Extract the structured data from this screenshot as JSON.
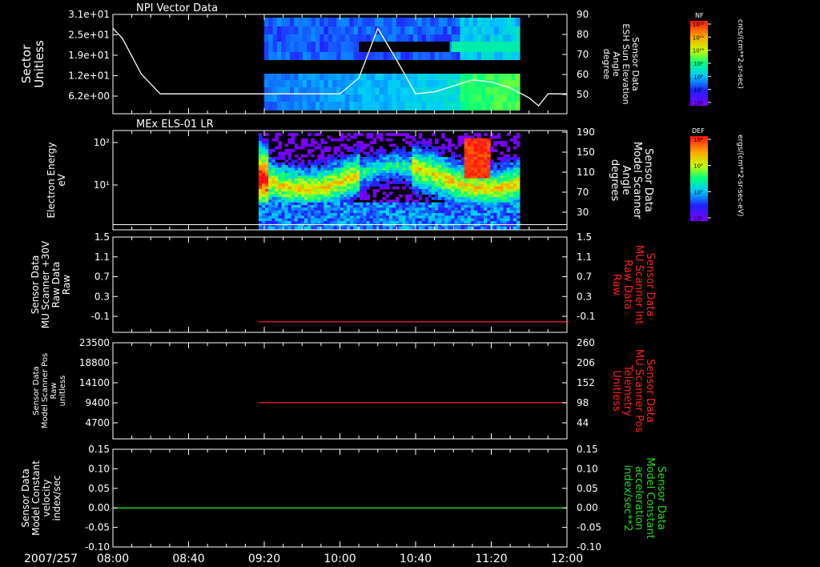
{
  "page": {
    "date_label": "2007/257",
    "time_ticks": [
      "08:00",
      "08:40",
      "09:20",
      "10:00",
      "10:40",
      "11:20",
      "12:00"
    ]
  },
  "colors": {
    "background": "#000000",
    "axis": "#ffffff",
    "red_trace": "#ff2020",
    "green_trace": "#22dd22",
    "right_label_red": "#ff2020",
    "right_label_green": "#22dd22"
  },
  "panels": [
    {
      "id": "npi",
      "title": "NPI Vector Data",
      "left_label": [
        "Sector",
        "Unitless"
      ],
      "left_ticks": [
        "3.1e+01",
        "2.5e+01",
        "1.9e+01",
        "1.2e+01",
        "6.2e+00"
      ],
      "right_label": [
        "Sensor Data",
        "ESH Sun Elevation",
        "Angle",
        "degree"
      ],
      "right_ticks": [
        "90",
        "80",
        "70",
        "60",
        "50"
      ],
      "colorbar_title": "NF",
      "colorbar_units": "cnts/(cm**2-sr-sec)",
      "colorbar_ticks": [
        "10¹²",
        "10¹¹",
        "10¹⁰",
        "10⁹",
        "10⁸",
        "10⁷",
        "10⁶"
      ]
    },
    {
      "id": "els",
      "title": "MEx ELS-01 LR",
      "left_label": [
        "Electron Energy",
        "eV"
      ],
      "left_ticks": [
        "10²",
        "10¹"
      ],
      "right_label": [
        "Sensor Data",
        "Model Scanner",
        "Angle",
        "degrees"
      ],
      "right_ticks": [
        "190",
        "150",
        "110",
        "70",
        "30"
      ],
      "colorbar_title": "DEF",
      "colorbar_units": "ergs/(cm**2-sr-sec-eV)",
      "colorbar_ticks": [
        "10⁴",
        "10³",
        "10²",
        "10¹"
      ]
    },
    {
      "id": "mu_raw",
      "left_label": [
        "Sensor Data",
        "MU Scanner +30V",
        "Raw Data",
        "Raw"
      ],
      "left_ticks": [
        "1.5",
        "1.1",
        "0.7",
        "0.3",
        "-0.1"
      ],
      "right_label": [
        "Sensor Data",
        "MU Scanner Int",
        "Raw Data",
        "Raw"
      ],
      "right_ticks": [
        "1.5",
        "1.1",
        "0.7",
        "0.3",
        "-0.1"
      ]
    },
    {
      "id": "scanner_pos",
      "left_label": [
        "Sensor Data",
        "Model Scanner Pos",
        "Raw",
        "unitless"
      ],
      "left_ticks": [
        "23500",
        "18800",
        "14100",
        "9400",
        "4700"
      ],
      "right_label": [
        "Sensor Data",
        "MU Scanner Pos",
        "Telemetry",
        "Unitless"
      ],
      "right_ticks": [
        "260",
        "206",
        "152",
        "98",
        "44"
      ]
    },
    {
      "id": "constant",
      "left_label": [
        "Sensor Data",
        "Model Constant",
        "velocity",
        "index/sec"
      ],
      "left_ticks": [
        "0.15",
        "0.10",
        "0.05",
        "0.00",
        "-0.05",
        "-0.10"
      ],
      "right_label": [
        "Sensor Data",
        "Model Constant",
        "acceleration",
        "index/sec**2"
      ],
      "right_ticks": [
        "0.15",
        "0.10",
        "0.05",
        "0.00",
        "-0.05",
        "-0.10"
      ]
    }
  ],
  "chart_data": [
    {
      "type": "heatmap",
      "title": "NPI Vector Data",
      "x_range": [
        "08:00",
        "12:00"
      ],
      "data_coverage": [
        "09:20",
        "11:35"
      ],
      "overlay_line": {
        "name": "ESH Sun Elevation Angle",
        "x": [
          "08:00",
          "08:05",
          "08:15",
          "08:25",
          "09:20",
          "10:00",
          "10:10",
          "10:20",
          "10:30",
          "10:40",
          "10:50",
          "11:00",
          "11:10",
          "11:20",
          "11:30",
          "11:40",
          "11:45",
          "11:50",
          "12:00"
        ],
        "y": [
          83,
          78,
          60,
          50,
          50,
          50,
          58,
          83,
          67,
          50,
          51,
          54,
          57,
          56,
          53,
          48,
          44,
          50,
          50
        ]
      }
    },
    {
      "type": "heatmap",
      "title": "MEx ELS-01 LR",
      "x_range": [
        "08:00",
        "12:00"
      ],
      "data_coverage": [
        "09:17",
        "11:35"
      ],
      "overlay_line": {
        "name": "Model Scanner Angle",
        "x": [
          "08:00",
          "12:00"
        ],
        "y": [
          10,
          10
        ]
      }
    },
    {
      "type": "line",
      "series": [
        {
          "name": "MU Scanner Int Raw",
          "x": [
            "09:17",
            "12:00"
          ],
          "y": [
            -0.1,
            -0.1
          ]
        }
      ],
      "ylim": [
        -0.3,
        1.5
      ]
    },
    {
      "type": "line",
      "series": [
        {
          "name": "MU Scanner Pos",
          "x": [
            "09:17",
            "12:00"
          ],
          "y": [
            98,
            98
          ]
        }
      ],
      "ylim": [
        0,
        260
      ]
    },
    {
      "type": "line",
      "series": [
        {
          "name": "Model Constant velocity",
          "x": [
            "08:00",
            "12:00"
          ],
          "y": [
            0.0,
            0.0
          ]
        }
      ],
      "ylim": [
        -0.1,
        0.15
      ]
    }
  ]
}
